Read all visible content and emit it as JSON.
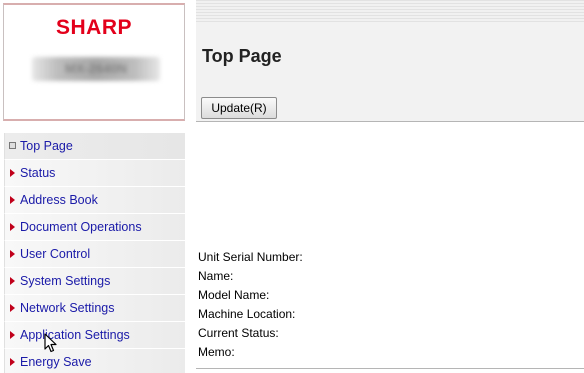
{
  "brand": {
    "name": "SHARP",
    "model": "MX-2640N"
  },
  "header": {
    "title": "Top Page",
    "update_label": "Update(R)"
  },
  "menu": {
    "items": [
      {
        "label": "Top Page",
        "active": true
      },
      {
        "label": "Status"
      },
      {
        "label": "Address Book"
      },
      {
        "label": "Document Operations"
      },
      {
        "label": "User Control"
      },
      {
        "label": "System Settings"
      },
      {
        "label": "Network Settings"
      },
      {
        "label": "Application Settings"
      },
      {
        "label": "Energy Save"
      }
    ]
  },
  "info": {
    "serial": "Unit Serial Number:",
    "name": "Name:",
    "model_name": "Model Name:",
    "location": "Machine Location:",
    "status": "Current Status:",
    "memo": "Memo:"
  },
  "colors": {
    "brand": "#e3001b",
    "link": "#1a1aa8",
    "marker": "#c0001a"
  }
}
